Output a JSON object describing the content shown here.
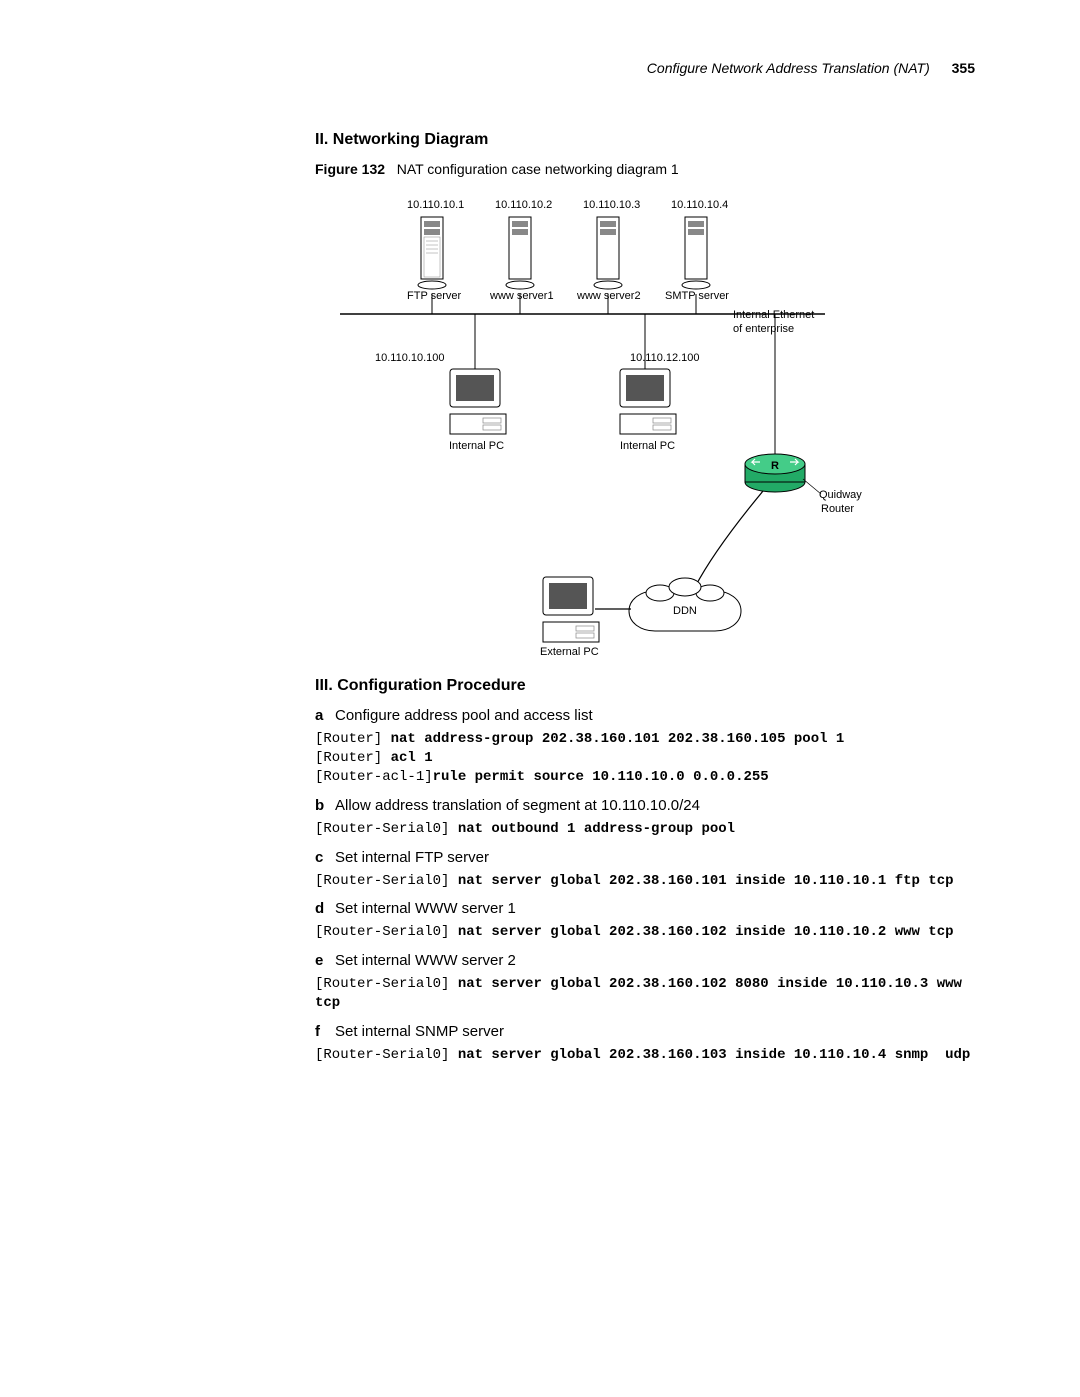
{
  "header": {
    "chapter": "Configure Network Address Translation (NAT)",
    "page_number": "355"
  },
  "section2": {
    "heading": "II. Networking Diagram",
    "figure_label": "Figure 132",
    "figure_caption": "NAT configuration case networking diagram 1"
  },
  "diagram": {
    "servers": [
      {
        "ip": "10.110.10.1",
        "name": "FTP server"
      },
      {
        "ip": "10.110.10.2",
        "name": "www server1"
      },
      {
        "ip": "10.110.10.3",
        "name": "www server2"
      },
      {
        "ip": "10.110.10.4",
        "name": "SMTP server"
      }
    ],
    "net_label_l1": "Internal Ethernet",
    "net_label_l2": "of enterprise",
    "pc1_ip": "10.110.10.100",
    "pc1_name": "Internal PC",
    "pc2_ip": "10.110.12.100",
    "pc2_name": "Internal PC",
    "router_l1": "Quidway",
    "router_l2": "Router",
    "ddn": "DDN",
    "ext_pc": "External PC"
  },
  "section3": {
    "heading": "III. Configuration Procedure",
    "steps": {
      "a": "Configure address pool and access list",
      "b": "Allow address translation of segment at 10.110.10.0/24",
      "c": "Set internal FTP server",
      "d": "Set internal WWW server 1",
      "e": "Set internal WWW server 2",
      "f": "Set internal SNMP server"
    },
    "code": {
      "a_p1": "[Router] ",
      "a_b1": "nat address-group 202.38.160.101 202.38.160.105 pool 1",
      "a_p2": "[Router] ",
      "a_b2": "acl 1",
      "a_p3": "[Router-acl-1]",
      "a_b3": "rule permit source 10.110.10.0 0.0.0.255",
      "b_p1": "[Router-Serial0] ",
      "b_b1": "nat outbound 1 address-group pool",
      "c_p1": "[Router-Serial0] ",
      "c_b1": "nat server global 202.38.160.101 inside 10.110.10.1 ftp tcp",
      "d_p1": "[Router-Serial0] ",
      "d_b1": "nat server global 202.38.160.102 inside 10.110.10.2 www tcp",
      "e_p1": "[Router-Serial0] ",
      "e_b1": "nat server global 202.38.160.102 8080 inside 10.110.10.3 www tcp",
      "f_p1": "[Router-Serial0] ",
      "f_b1": "nat server global 202.38.160.103 inside 10.110.10.4 snmp  udp"
    }
  }
}
